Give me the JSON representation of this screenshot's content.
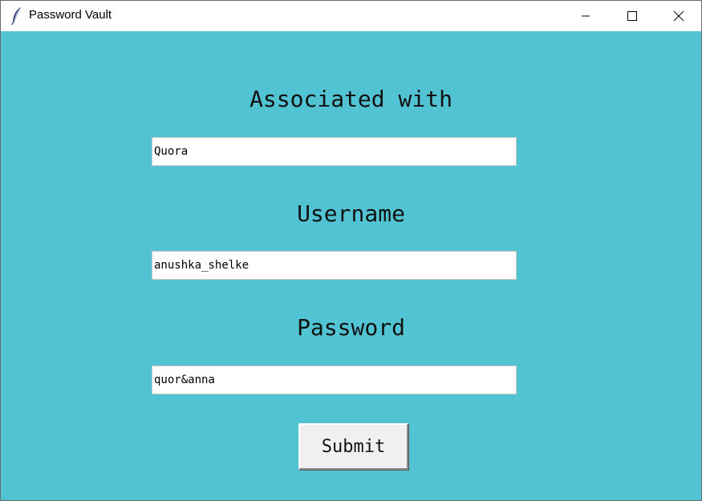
{
  "window": {
    "title": "Password Vault",
    "icon": "feather-icon",
    "controls": [
      "minimize-icon",
      "maximize-icon",
      "close-icon"
    ]
  },
  "form": {
    "associated_label": "Associated with",
    "associated_value": "Quora",
    "username_label": "Username",
    "username_value": "anushka_shelke",
    "password_label": "Password",
    "password_value": "quor&anna",
    "submit_label": "Submit"
  },
  "colors": {
    "background": "#52c3d3",
    "field_background": "#ffffff",
    "button_background": "#f0f0f0"
  }
}
